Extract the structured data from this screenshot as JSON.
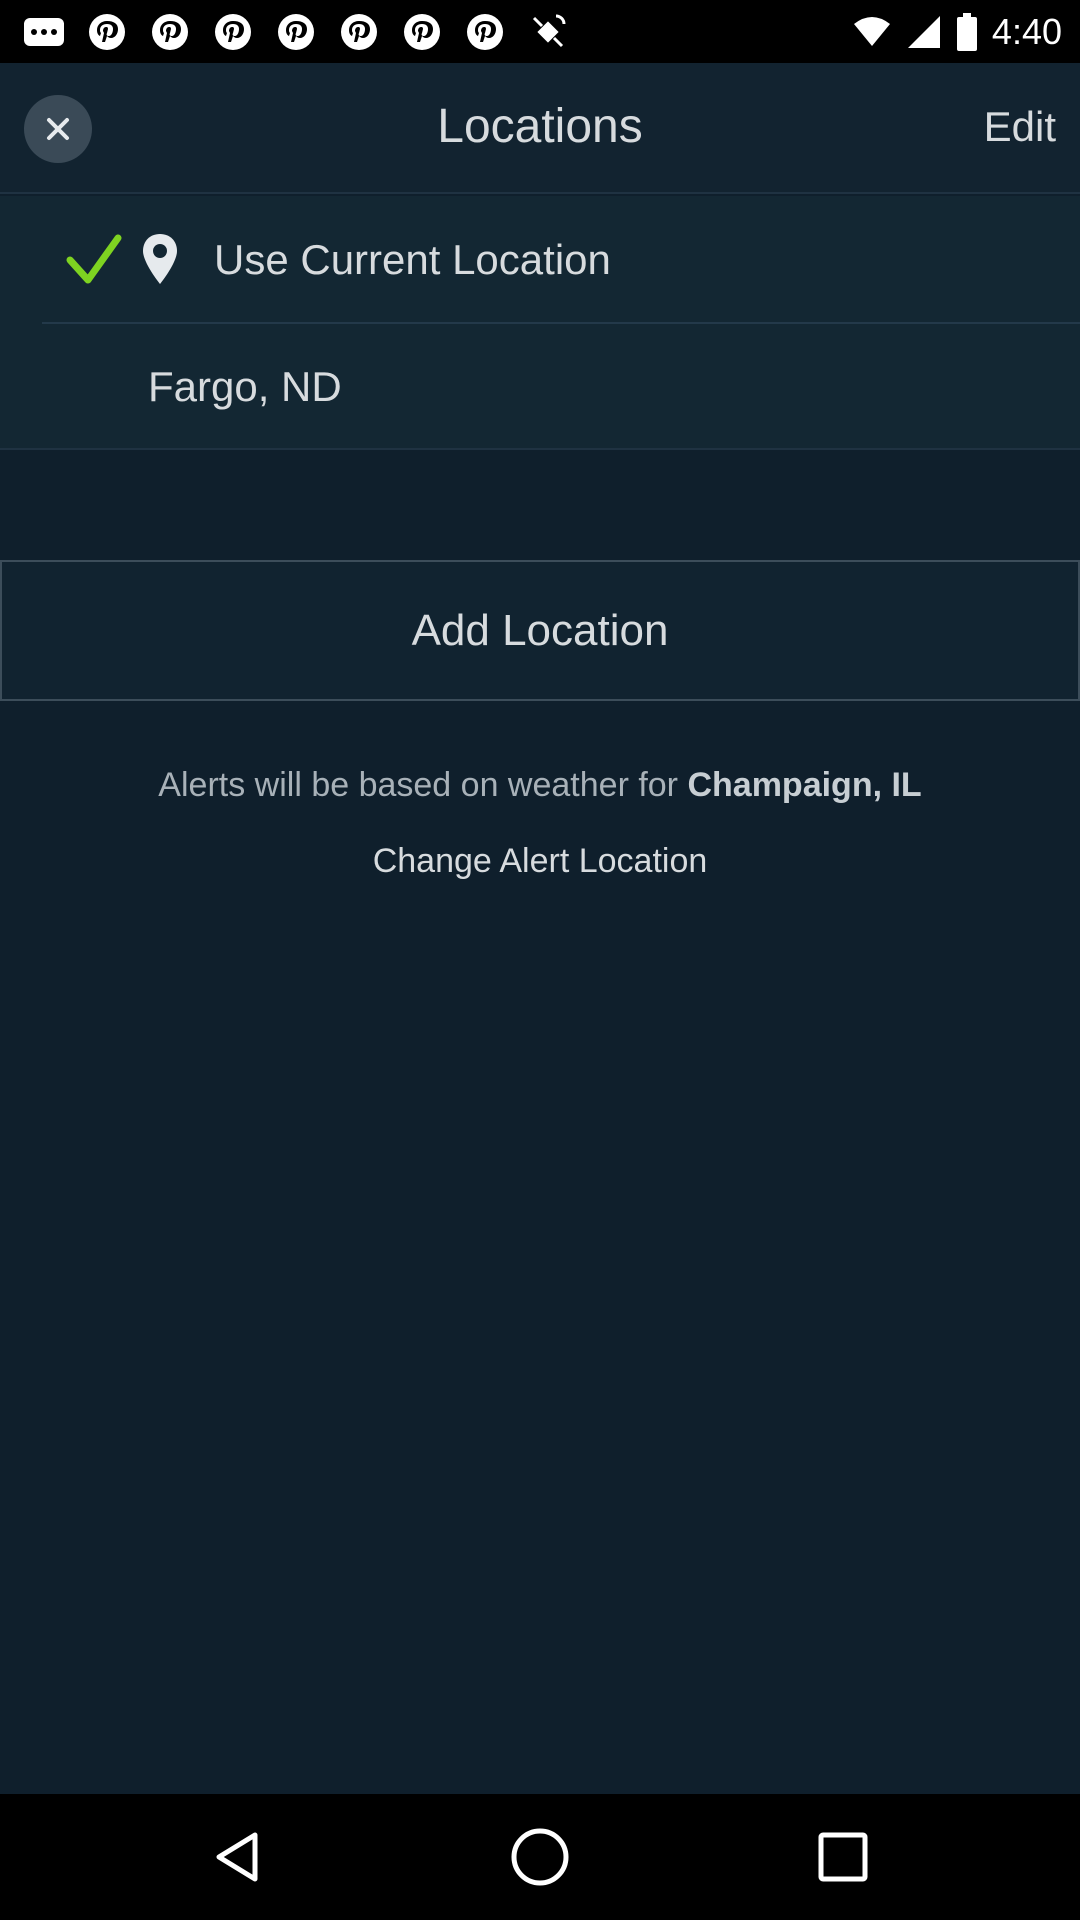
{
  "status_bar": {
    "time": "4:40"
  },
  "header": {
    "title": "Locations",
    "edit_label": "Edit"
  },
  "locations": [
    {
      "label": "Use Current Location",
      "selected": true,
      "is_current": true
    },
    {
      "label": "Fargo, ND",
      "selected": false,
      "is_current": false
    }
  ],
  "add_location_label": "Add Location",
  "alert": {
    "prefix": "Alerts will be based on weather for",
    "location": "Champaign, IL",
    "change_label": "Change Alert Location"
  },
  "colors": {
    "background": "#0f1f2c",
    "check_accent": "#7ed321"
  }
}
